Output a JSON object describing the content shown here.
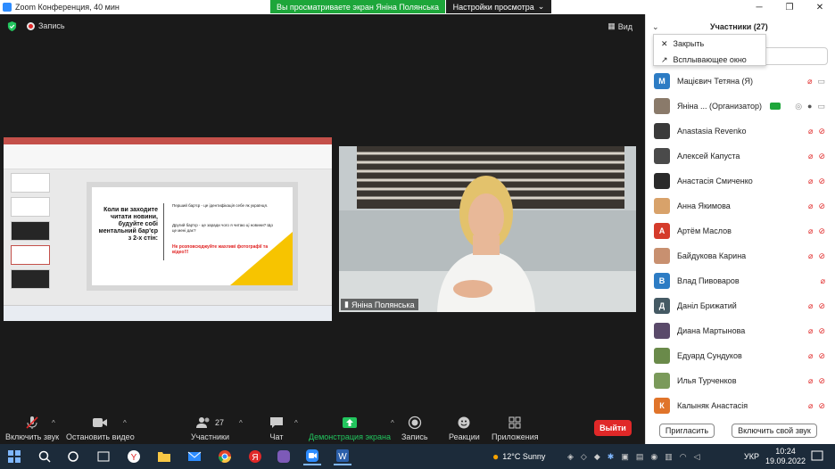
{
  "window": {
    "title": "Zoom Конференция, 40 мин",
    "share_banner": "Вы просматриваете экран Яніна Полянська",
    "view_options": "Настройки просмотра",
    "controls": [
      "─",
      "❐",
      "✕"
    ]
  },
  "meeting": {
    "record_label": "Запись",
    "view_label": "Вид",
    "video_name": "Яніна Полянська",
    "slide": {
      "question": "Коли ви заходите читати новини, будуйте собі ментальний бар'єр з 2-х стін:",
      "bullet1": "Перший бар'єр - це ідентифікація себе як українця.",
      "bullet2": "Другий бар'єр - це заради чого я читаю ці новини? Що це мені дає?",
      "warning": "Не розповсюджуйте жахливі фотографії та відео!!!"
    }
  },
  "toolbar": {
    "unmute": "Включить звук",
    "video": "Остановить видео",
    "participants": "Участники",
    "participants_count": "27",
    "chat": "Чат",
    "share": "Демонстрация экрана",
    "record": "Запись",
    "reactions": "Реакции",
    "apps": "Приложения",
    "leave": "Выйти"
  },
  "panel": {
    "title": "Участники (27)",
    "menu": {
      "close": "Закрыть",
      "popout": "Всплывающее окно"
    },
    "participants": [
      {
        "name": "Мацієвич Тетяна (Я)",
        "initial": "М",
        "color": "#2d7cc4"
      },
      {
        "name": "Яніна ...   (Организатор)",
        "initial": "",
        "color": "#8a7a6a"
      },
      {
        "name": "Anastasia Revenko",
        "initial": "",
        "color": "#3a3a3a"
      },
      {
        "name": "Алексей Капуста",
        "initial": "",
        "color": "#4a4a4a"
      },
      {
        "name": "Анастасія Смиченко",
        "initial": "",
        "color": "#2a2a2a"
      },
      {
        "name": "Анна Якимова",
        "initial": "",
        "color": "#d8a26a"
      },
      {
        "name": "Артём Маслов",
        "initial": "А",
        "color": "#d53b2b"
      },
      {
        "name": "Байдукова Карина",
        "initial": "",
        "color": "#c89070"
      },
      {
        "name": "Влад Пивоваров",
        "initial": "В",
        "color": "#2d7cc4"
      },
      {
        "name": "Даніл Брижатий",
        "initial": "Д",
        "color": "#455a64"
      },
      {
        "name": "Диана Мартынова",
        "initial": "",
        "color": "#5a4a6a"
      },
      {
        "name": "Едуард Сундуков",
        "initial": "",
        "color": "#6a8a4a"
      },
      {
        "name": "Илья Турченков",
        "initial": "",
        "color": "#7a9a5a"
      },
      {
        "name": "Калыняк Анастасія",
        "initial": "К",
        "color": "#e0742a"
      }
    ],
    "invite": "Пригласить",
    "unmute_self": "Включить свой звук"
  },
  "taskbar": {
    "weather": "12°C  Sunny",
    "lang": "УКР",
    "time": "10:24",
    "date": "19.09.2022"
  }
}
